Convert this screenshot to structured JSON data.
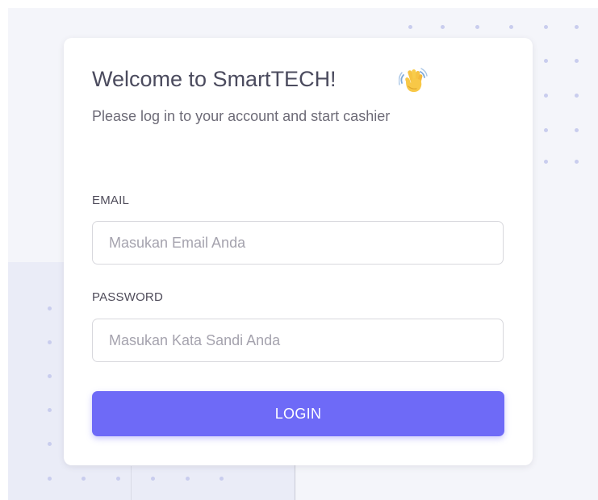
{
  "login": {
    "title": "Welcome to SmartTECH!",
    "title_icon": "waving-hand-icon",
    "subtitle": "Please log in to your account and start cashier",
    "email": {
      "label": "EMAIL",
      "value": "",
      "placeholder": "Masukan Email Anda"
    },
    "password": {
      "label": "PASSWORD",
      "value": "",
      "placeholder": "Masukan Kata Sandi Anda"
    },
    "submit_label": "LOGIN"
  },
  "colors": {
    "primary": "#6e6af7",
    "background": "#f4f5fa",
    "card": "#ffffff",
    "heading": "#4b4b5e",
    "decor_dots": "#c9cdee"
  }
}
